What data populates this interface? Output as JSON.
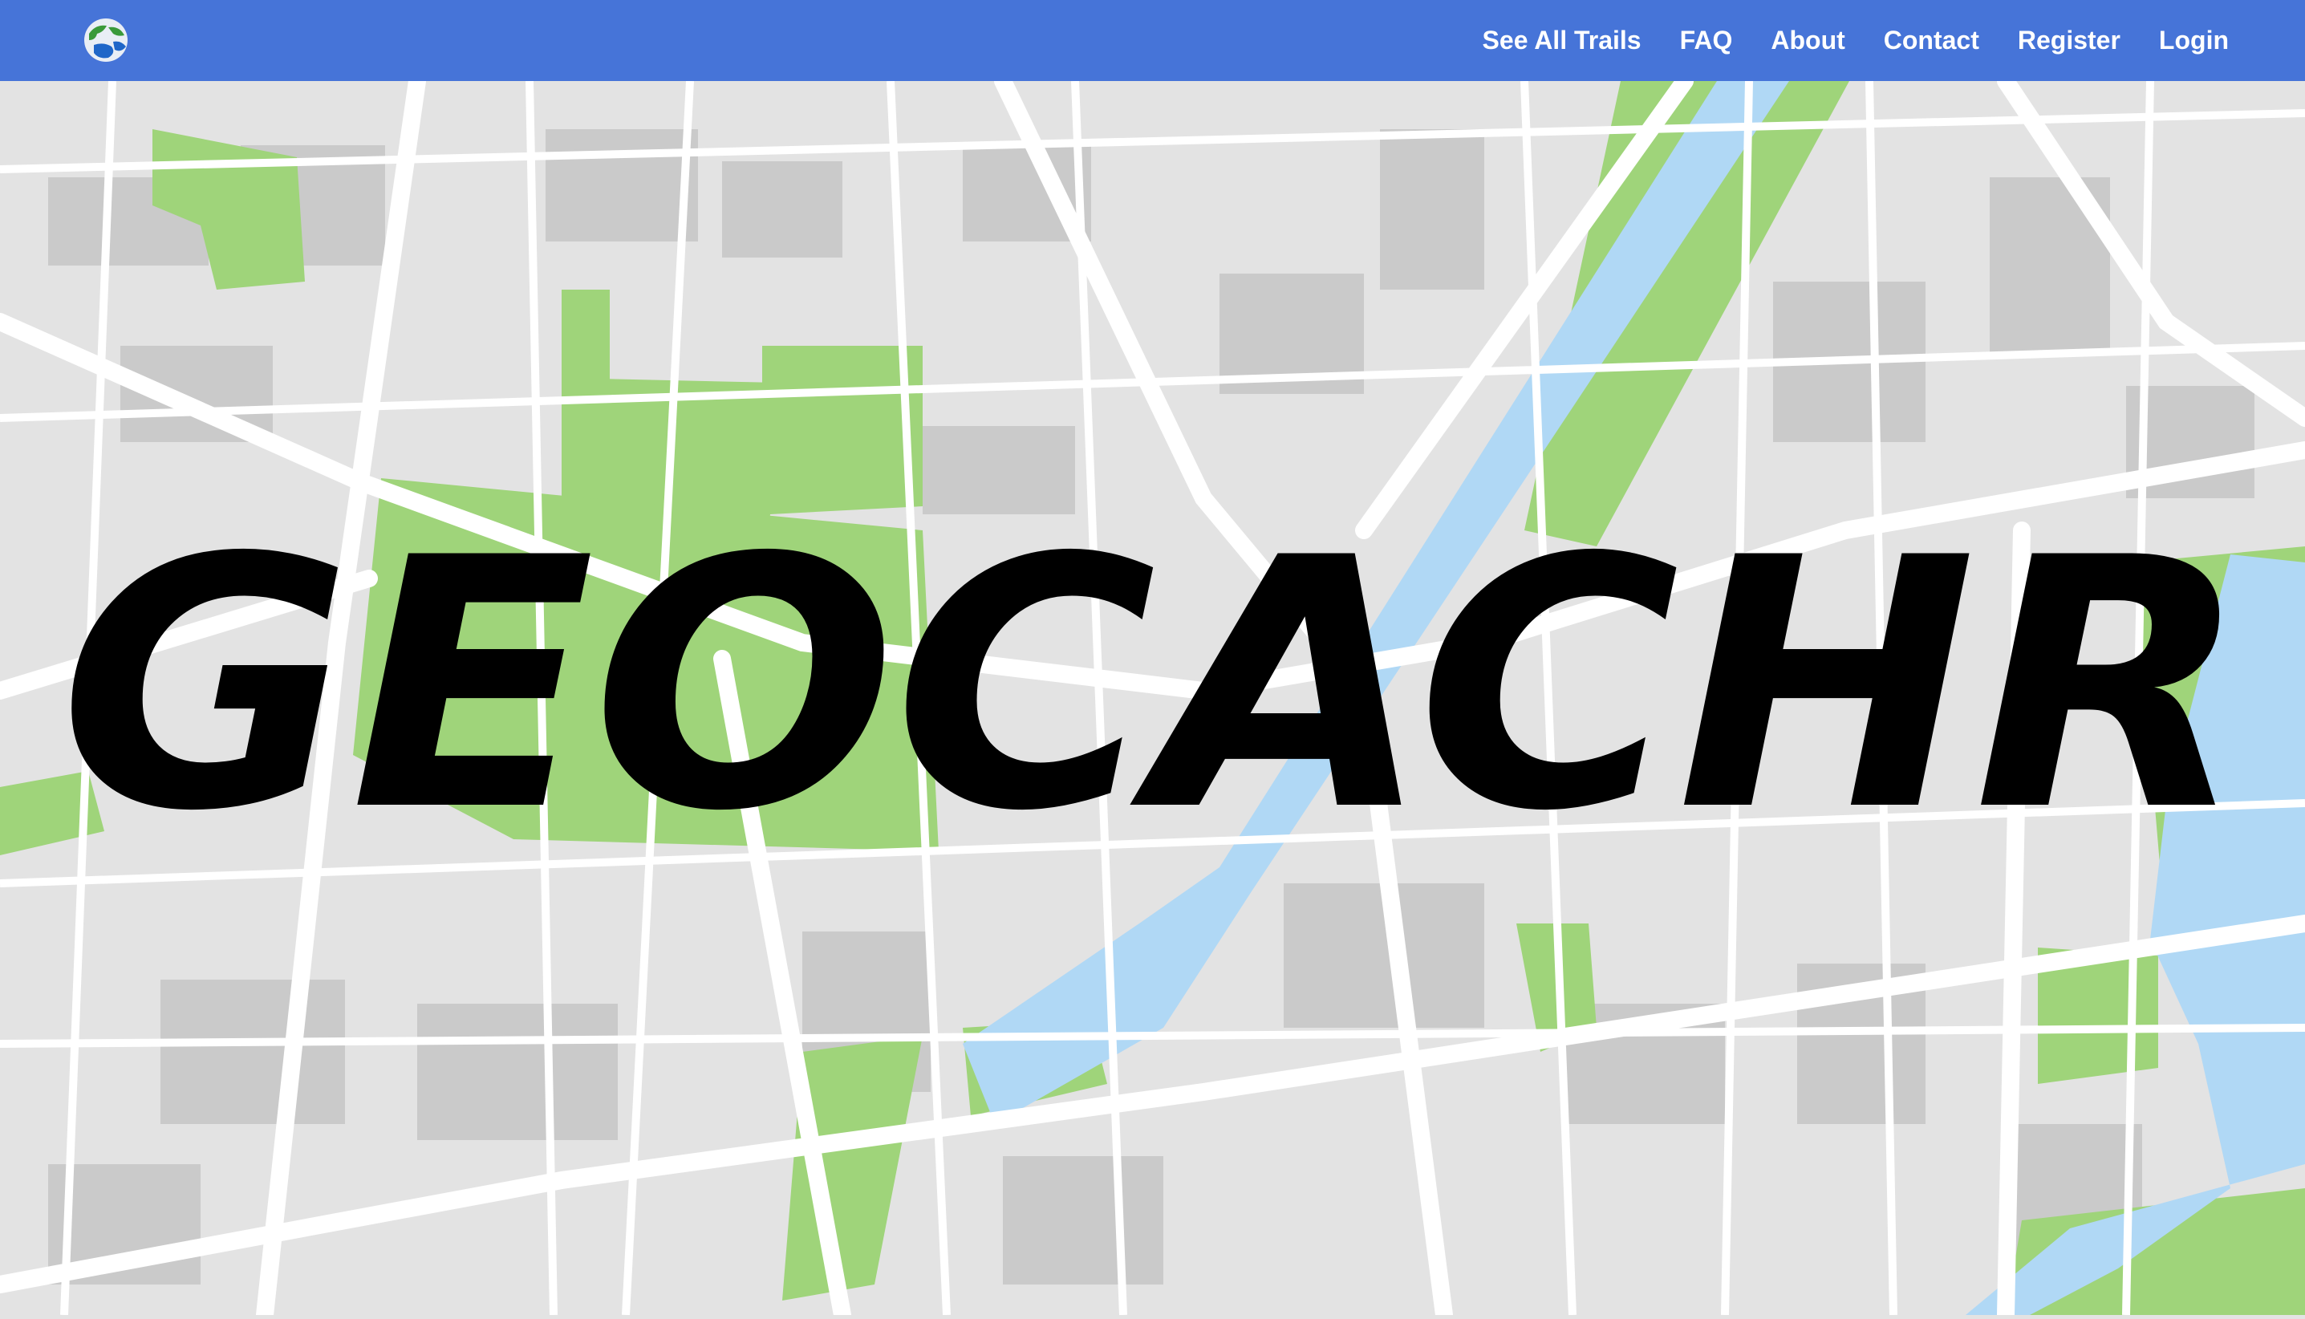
{
  "brand": {
    "logo_icon": "globe-icon",
    "colors": {
      "nav": "#4674d8",
      "water": "#b0d8f5",
      "park": "#9fd47a",
      "road": "#ffffff",
      "land": "#e3e3e3",
      "block": "#cacaca"
    }
  },
  "nav": {
    "items": [
      {
        "label": "See All Trails"
      },
      {
        "label": "FAQ"
      },
      {
        "label": "About"
      },
      {
        "label": "Contact"
      },
      {
        "label": "Register"
      },
      {
        "label": "Login"
      }
    ]
  },
  "hero": {
    "title": "GEOCACHR",
    "background": "city-map-illustration"
  }
}
